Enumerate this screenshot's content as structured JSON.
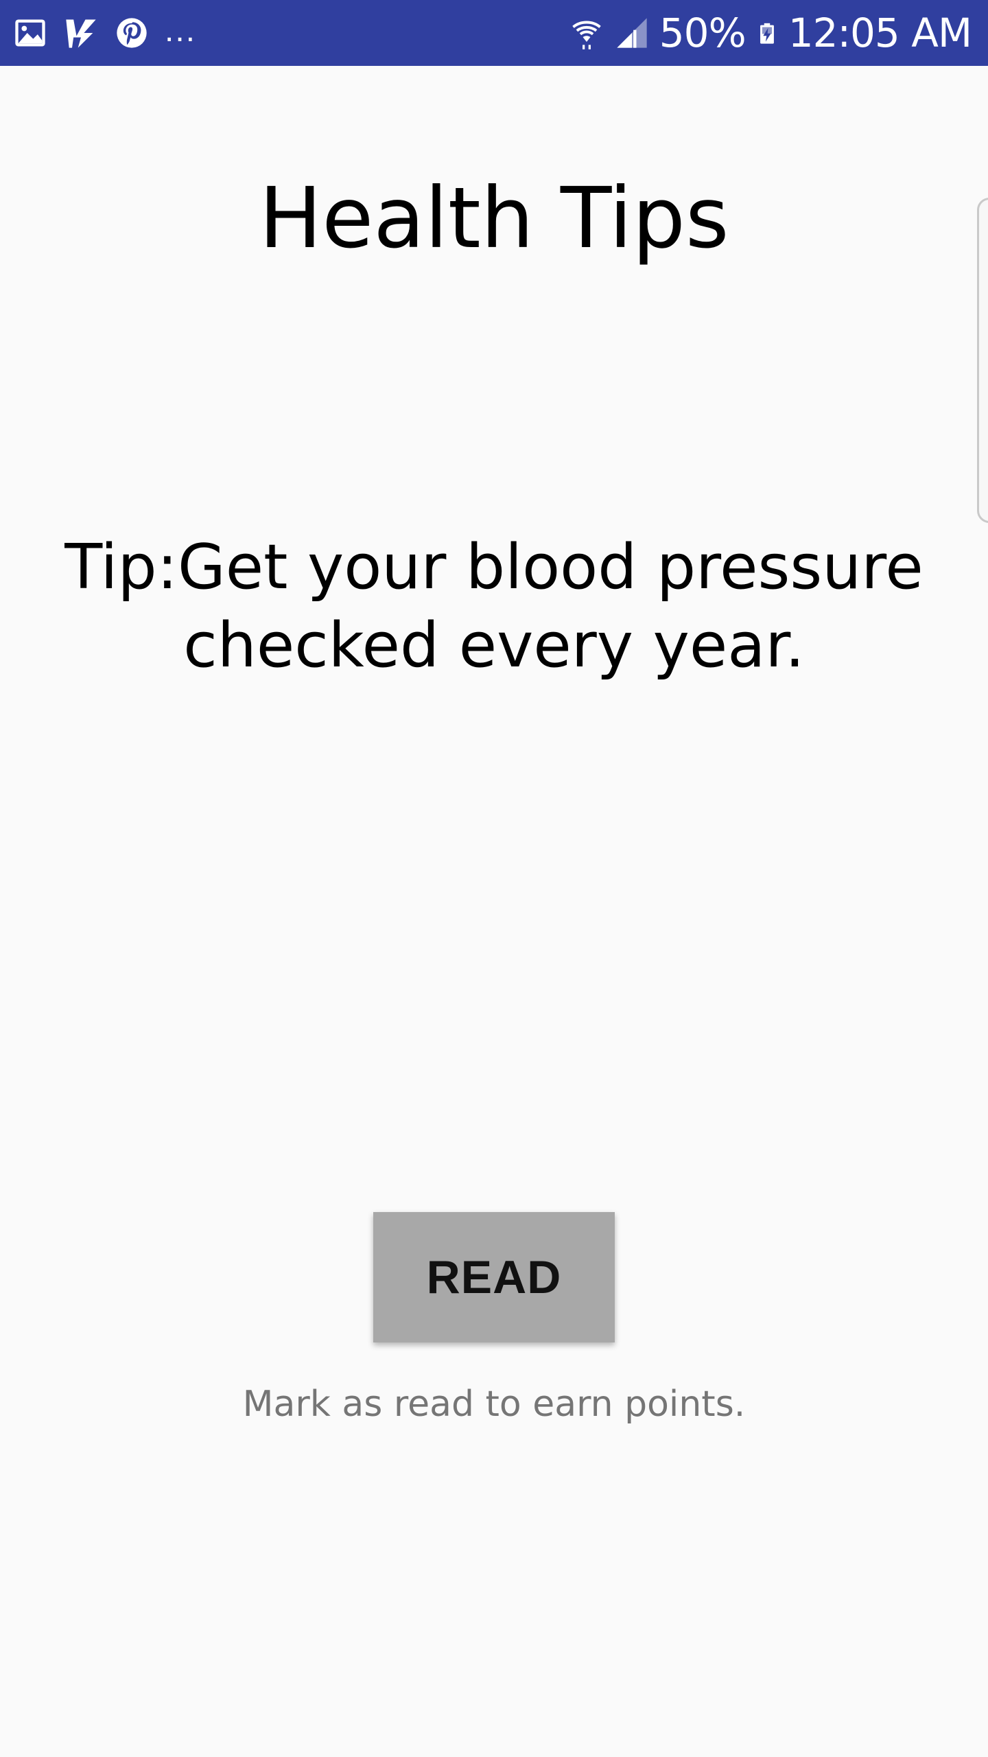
{
  "status_bar": {
    "notification_icons": [
      "gallery-icon",
      "vs-app-icon",
      "pinterest-icon"
    ],
    "overflow": "...",
    "battery_percent": "50%",
    "time": "12:05 AM",
    "background_color": "#303f9f"
  },
  "main": {
    "title": "Health Tips",
    "tip_text": "Tip:Get your blood pressure checked every year.",
    "read_button_label": "READ",
    "hint_text": "Mark as read to earn points."
  },
  "colors": {
    "background": "#fafafa",
    "button": "#a8a8a8",
    "hint": "#757575"
  }
}
